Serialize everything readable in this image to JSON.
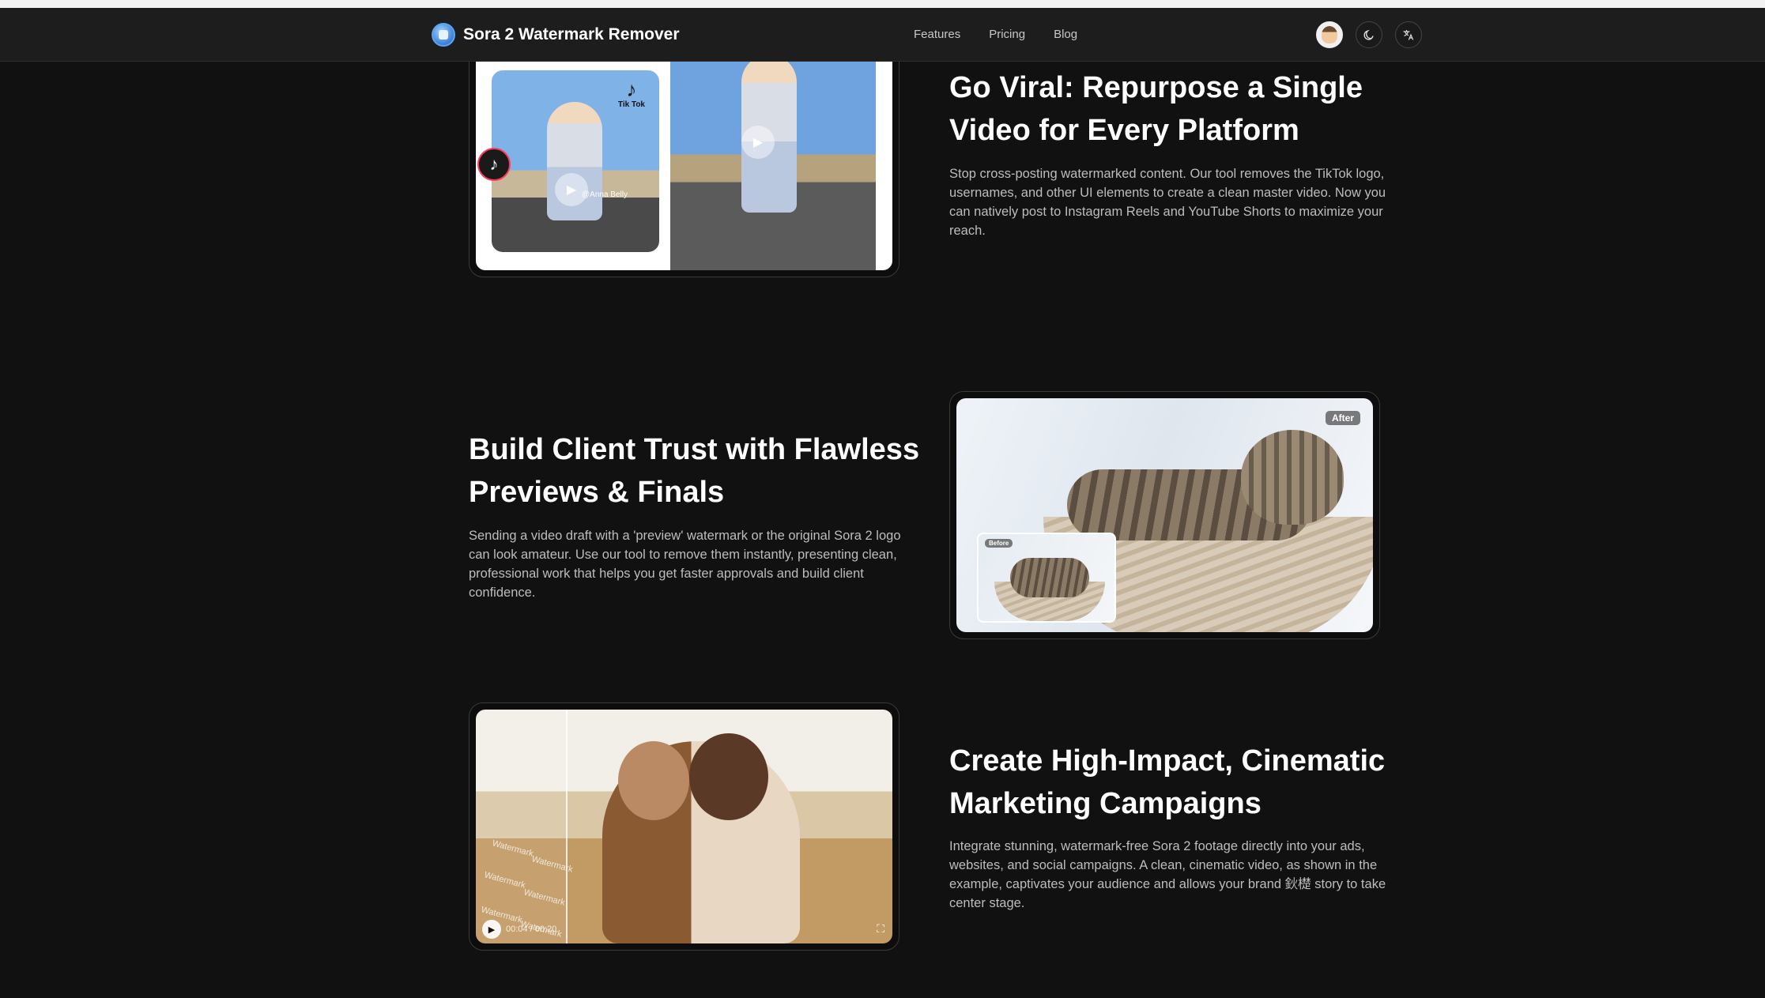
{
  "header": {
    "brand": "Sora 2 Watermark Remover",
    "nav": [
      "Features",
      "Pricing",
      "Blog"
    ]
  },
  "icons": {
    "logo": "app-logo-icon",
    "avatar": "user-avatar",
    "theme": "moon-icon",
    "language": "translate-icon"
  },
  "sections": [
    {
      "title_line1": "Go Viral: Repurpose a Single",
      "title_line2": "Video for Every Platform",
      "body": "Stop cross-posting watermarked content. Our tool removes the TikTok logo, usernames, and other UI elements to create a clean master video. Now you can natively post to Instagram Reels and YouTube Shorts to maximize your reach.",
      "image": {
        "tiktok_label": "Tik Tok",
        "handle": "@Anna Belly"
      }
    },
    {
      "title_line1": "Build Client Trust with Flawless",
      "title_line2": "Previews & Finals",
      "body": "Sending a video draft with a 'preview' watermark or the original Sora 2 logo can look amateur. Use our tool to remove them instantly, presenting clean, professional work that helps you get faster approvals and build client confidence.",
      "image": {
        "after_label": "After",
        "before_label": "Before"
      }
    },
    {
      "title_line1": "Create High-Impact, Cinematic",
      "title_line2": "Marketing Campaigns",
      "body": "Integrate stunning, watermark-free Sora 2 footage directly into your ads, websites, and social campaigns. A clean, cinematic video, as shown in the example, captivates your audience and allows your brand 鈥檚 story to take center stage.",
      "image": {
        "watermark_word": "Watermark",
        "time": "00:04 / 00:20"
      }
    }
  ],
  "colors": {
    "background": "#111111",
    "header": "#1d1d1d",
    "heading": "#ffffff",
    "body_text": "#bdbdbd"
  }
}
